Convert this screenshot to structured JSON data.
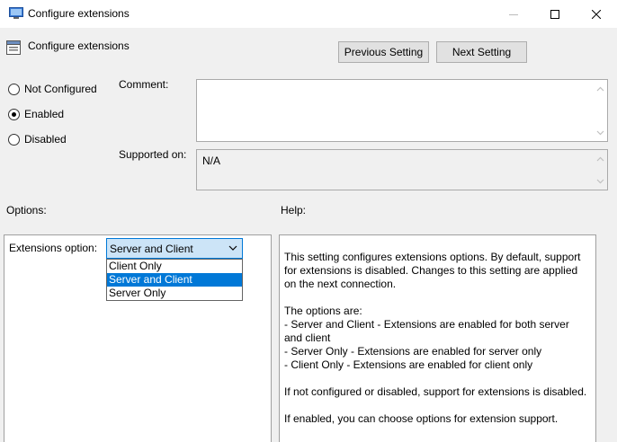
{
  "window": {
    "title": "Configure extensions",
    "icon": "policy-icon"
  },
  "header": {
    "title": "Configure extensions",
    "previous_button": "Previous Setting",
    "next_button": "Next Setting"
  },
  "state": {
    "options": [
      {
        "label": "Not Configured",
        "selected": false
      },
      {
        "label": "Enabled",
        "selected": true
      },
      {
        "label": "Disabled",
        "selected": false
      }
    ]
  },
  "comment": {
    "label": "Comment:",
    "value": ""
  },
  "supported_on": {
    "label": "Supported on:",
    "value": "N/A"
  },
  "options_section": {
    "label": "Options:",
    "extensions_label": "Extensions option:",
    "selected_value": "Server and Client",
    "dropdown_items": [
      "Client Only",
      "Server and Client",
      "Server Only"
    ],
    "highlighted_item": "Server and Client"
  },
  "help_section": {
    "label": "Help:",
    "paragraphs": [
      "This setting configures extensions options. By default, support for extensions is disabled. Changes to this setting are applied on the next connection.",
      "The options are:\n- Server and Client - Extensions are enabled for both server and client\n- Server Only - Extensions are enabled for server only\n- Client Only - Extensions are enabled for client only",
      "If not configured or disabled, support for extensions is disabled.",
      "If enabled, you can choose options for extension support."
    ]
  },
  "colors": {
    "accent": "#0078d7",
    "dialog_bg": "#f0f0f0",
    "select_bg": "#cce4f7"
  }
}
